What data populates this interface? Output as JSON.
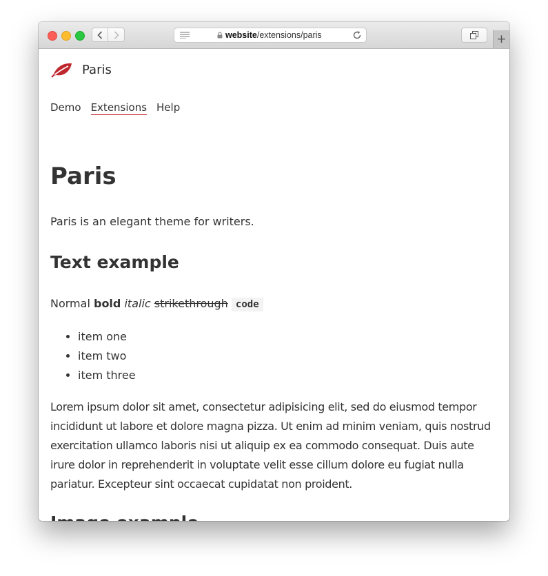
{
  "browser": {
    "url_host": "website",
    "url_path": "/extensions/paris"
  },
  "site": {
    "logo_icon": "leaf-icon",
    "brand_color": "#c0262d",
    "name": "Paris",
    "nav": [
      {
        "label": "Demo",
        "active": false
      },
      {
        "label": "Extensions",
        "active": true
      },
      {
        "label": "Help",
        "active": false
      }
    ]
  },
  "page": {
    "title": "Paris",
    "intro": "Paris is an elegant theme for writers.",
    "text_example": {
      "heading": "Text example",
      "normal": "Normal",
      "bold": "bold",
      "italic": "italic",
      "strikethrough": "strikethrough",
      "code": "code",
      "list": [
        "item one",
        "item two",
        "item three"
      ],
      "paragraph": "Lorem ipsum dolor sit amet, consectetur adipisicing elit, sed do eiusmod tempor incididunt ut labore et dolore magna pizza. Ut enim ad minim veniam, quis nostrud exercitation ullamco laboris nisi ut aliquip ex ea commodo consequat. Duis aute irure dolor in reprehenderit in voluptate velit esse cillum dolore eu fugiat nulla pariatur. Excepteur sint occaecat cupidatat non proident."
    },
    "image_example": {
      "heading": "Image example"
    }
  }
}
